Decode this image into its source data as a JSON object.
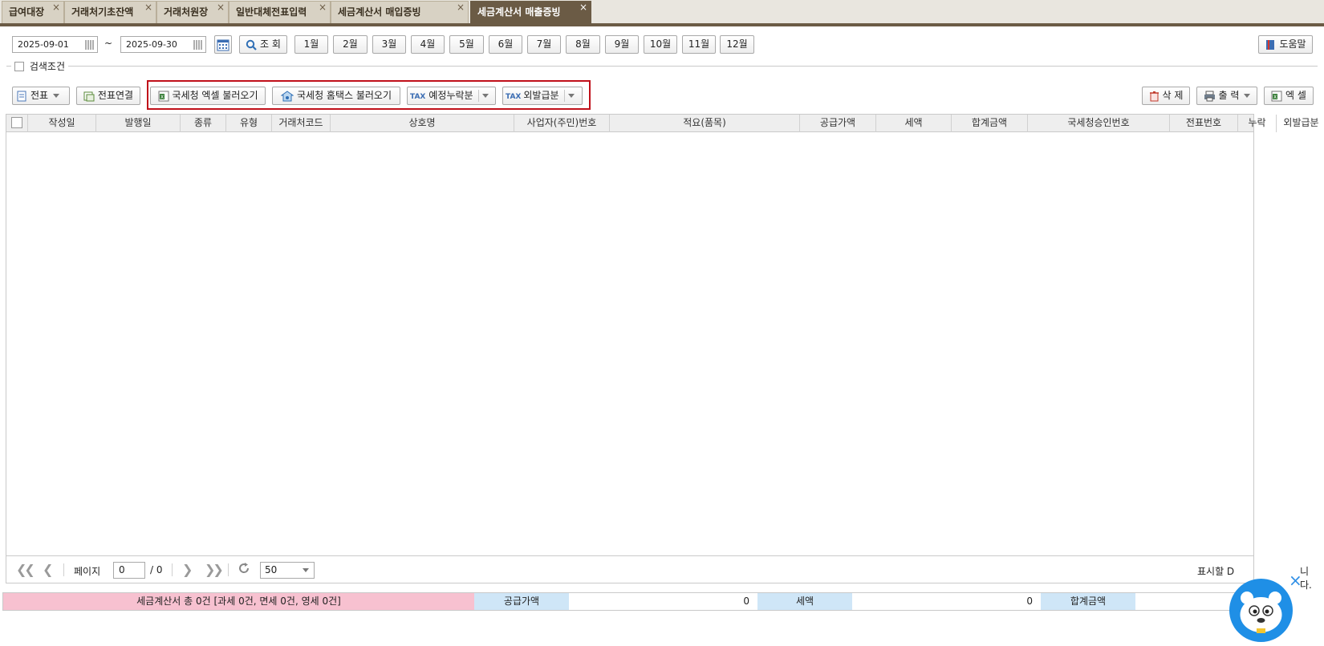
{
  "tabs": [
    {
      "label": "급여대장"
    },
    {
      "label": "거래처기초잔액"
    },
    {
      "label": "거래처원장"
    },
    {
      "label": "일반대체전표입력"
    },
    {
      "label": "세금계산서 매입증빙"
    },
    {
      "label": "세금계산서 매출증빙"
    }
  ],
  "tab_close_glyph": "×",
  "toolbar": {
    "date_from": "2025-09-01",
    "tilde": "~",
    "date_to": "2025-09-30",
    "search_label": "조 회",
    "months": [
      "1월",
      "2월",
      "3월",
      "4월",
      "5월",
      "6월",
      "7월",
      "8월",
      "9월",
      "10월",
      "11월",
      "12월"
    ],
    "help_label": "도움말"
  },
  "search_condition_label": "검색조건",
  "actions": {
    "voucher_label": "전표",
    "voucher_link_label": "전표연결",
    "nts_excel_label": "국세청 엑셀 불러오기",
    "nts_hometax_label": "국세청 홈택스 불러오기",
    "tax_tag": "TAX",
    "scheduled_omission_label": "예정누락분",
    "late_issue_label": "외발급분",
    "delete_label": "삭 제",
    "print_label": "출 력",
    "excel_label": "엑 셀"
  },
  "grid": {
    "columns": [
      "작성일",
      "발행일",
      "종류",
      "유형",
      "거래처코드",
      "상호명",
      "사업자(주민)번호",
      "적요(품목)",
      "공급가액",
      "세액",
      "합계금액",
      "국세청승인번호",
      "전표번호",
      "누락",
      "외발급분"
    ]
  },
  "pager": {
    "page_label": "페이지",
    "page_value": "0",
    "total_pages": "/ 0",
    "page_size": "50",
    "empty_msg_visible": "표시할 D",
    "empty_msg_tail": "니다."
  },
  "summary": {
    "total_text": "세금계산서 총 0건 [과세 0건, 면세 0건, 영세 0건]",
    "supply_label": "공급가액",
    "supply_value": "0",
    "tax_label": "세액",
    "tax_value": "0",
    "sum_label": "합계금액",
    "sum_value": "0"
  },
  "colors": {
    "tab_active": "#6b5b45",
    "highlight_box": "#c0101a",
    "summary_pink": "#f7c1d0",
    "summary_blue": "#cfe6f7",
    "mascot_blue": "#1f8fe6"
  },
  "mascot": {
    "close_glyph": "×"
  }
}
